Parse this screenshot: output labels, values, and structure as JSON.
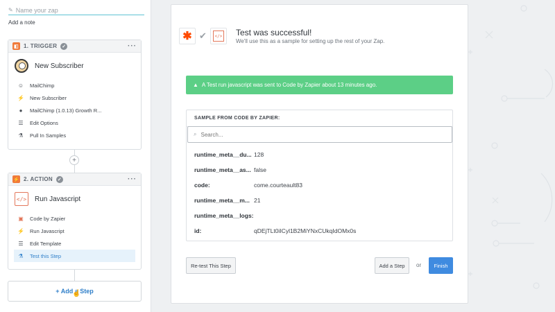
{
  "editor": {
    "zap_name_placeholder": "Name your zap",
    "add_note_label": "Add a note"
  },
  "trigger": {
    "header_label": "1. TRIGGER",
    "menu_label": "···",
    "title": "New Subscriber",
    "items": [
      {
        "icon": "mailchimp-icon",
        "label": "MailChimp"
      },
      {
        "icon": "bolt-icon",
        "label": "New Subscriber"
      },
      {
        "icon": "person-icon",
        "label": "MailChimp (1.0.13) Growth R..."
      },
      {
        "icon": "list-icon",
        "label": "Edit Options"
      },
      {
        "icon": "flask-icon",
        "label": "Pull In Samples"
      }
    ]
  },
  "action": {
    "header_label": "2. ACTION",
    "menu_label": "···",
    "title": "Run Javascript",
    "items": [
      {
        "icon": "code-icon",
        "label": "Code by Zapier"
      },
      {
        "icon": "bolt-icon",
        "label": "Run Javascript"
      },
      {
        "icon": "list-icon",
        "label": "Edit Template"
      },
      {
        "icon": "flask-icon",
        "label": "Test this Step",
        "active": true
      }
    ]
  },
  "add_step_label": "+ Add a Step",
  "main": {
    "title": "Test was successful!",
    "subtitle": "We'll use this as a sample for setting up the rest of your Zap.",
    "alert_text": "A Test run javascript was sent to Code by Zapier about 13 minutes ago.",
    "sample": {
      "heading": "SAMPLE FROM CODE BY ZAPIER:",
      "search_placeholder": "Search...",
      "rows": [
        {
          "key": "runtime_meta__du...",
          "value": "128"
        },
        {
          "key": "runtime_meta__as...",
          "value": "false"
        },
        {
          "key": "code:",
          "value": "come.courteault83"
        },
        {
          "key": "runtime_meta__m...",
          "value": "21"
        },
        {
          "key": "runtime_meta__logs:",
          "value": ""
        },
        {
          "key": "id:",
          "value": "qDEjTLt0iICyl1B2MiYNxCUkqIdOMx0s"
        }
      ]
    },
    "retest_label": "Re-test This Step",
    "add_step_label": "Add a Step",
    "or_label": "or",
    "finish_label": "Finish"
  },
  "colors": {
    "success": "#5ccf86",
    "primary": "#3f8be0",
    "zapier_orange": "#ff4a00",
    "active_item": "#2f7fc9"
  }
}
